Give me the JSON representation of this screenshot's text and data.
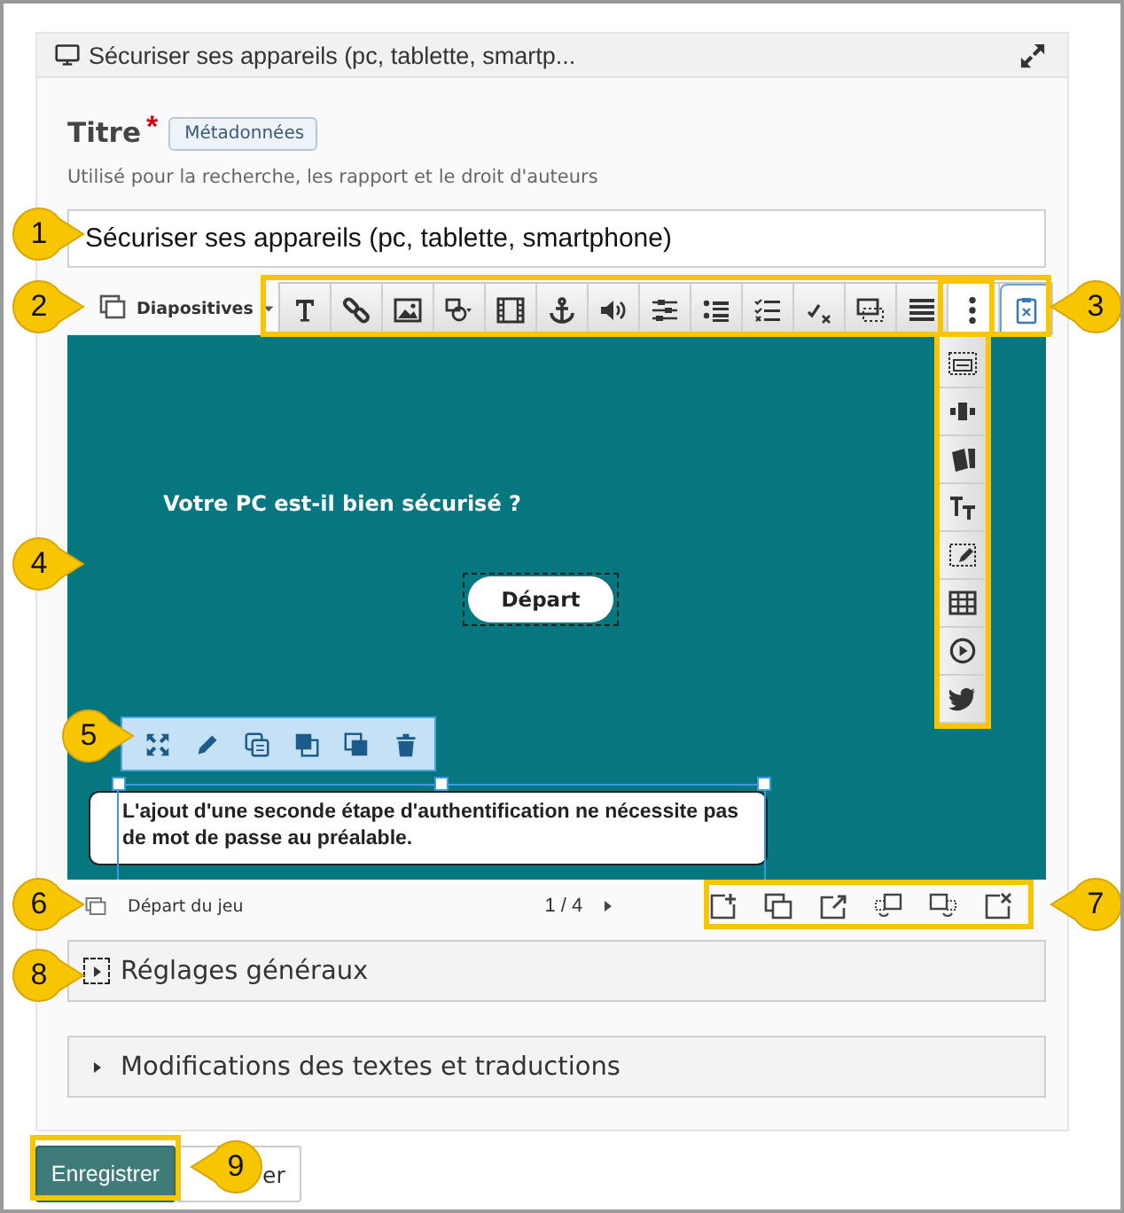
{
  "header": {
    "title": "Sécuriser ses appareils (pc, tablette, smartp..."
  },
  "title_field": {
    "label": "Titre",
    "required_mark": "*",
    "tag": "Métadonnées",
    "help": "Utilisé pour la recherche, les rapport et le droit d'auteurs",
    "value": "Sécuriser ses appareils (pc, tablette, smartphone)"
  },
  "editor": {
    "mode": "Diapositives",
    "question": "Votre PC est-il bien sécurisé ?",
    "start_button": "Départ",
    "text_box": "L'ajout d'une seconde étape d'authentification ne nécessite pas de mot de passe au préalable.",
    "slide_name": "Départ du jeu",
    "page": "1 / 4"
  },
  "sections": [
    {
      "label": "Réglages généraux",
      "focused": true
    },
    {
      "label": "Modifications des textes et traductions",
      "focused": false
    }
  ],
  "buttons": [
    {
      "label": "Enregistrer",
      "kind": "primary"
    },
    {
      "label": "er",
      "kind": "secondary"
    }
  ],
  "callouts": [
    {
      "label": "1"
    },
    {
      "label": "2"
    },
    {
      "label": "3"
    },
    {
      "label": "4"
    },
    {
      "label": "5"
    },
    {
      "label": "6"
    },
    {
      "label": "7"
    },
    {
      "label": "8"
    },
    {
      "label": "9"
    }
  ]
}
